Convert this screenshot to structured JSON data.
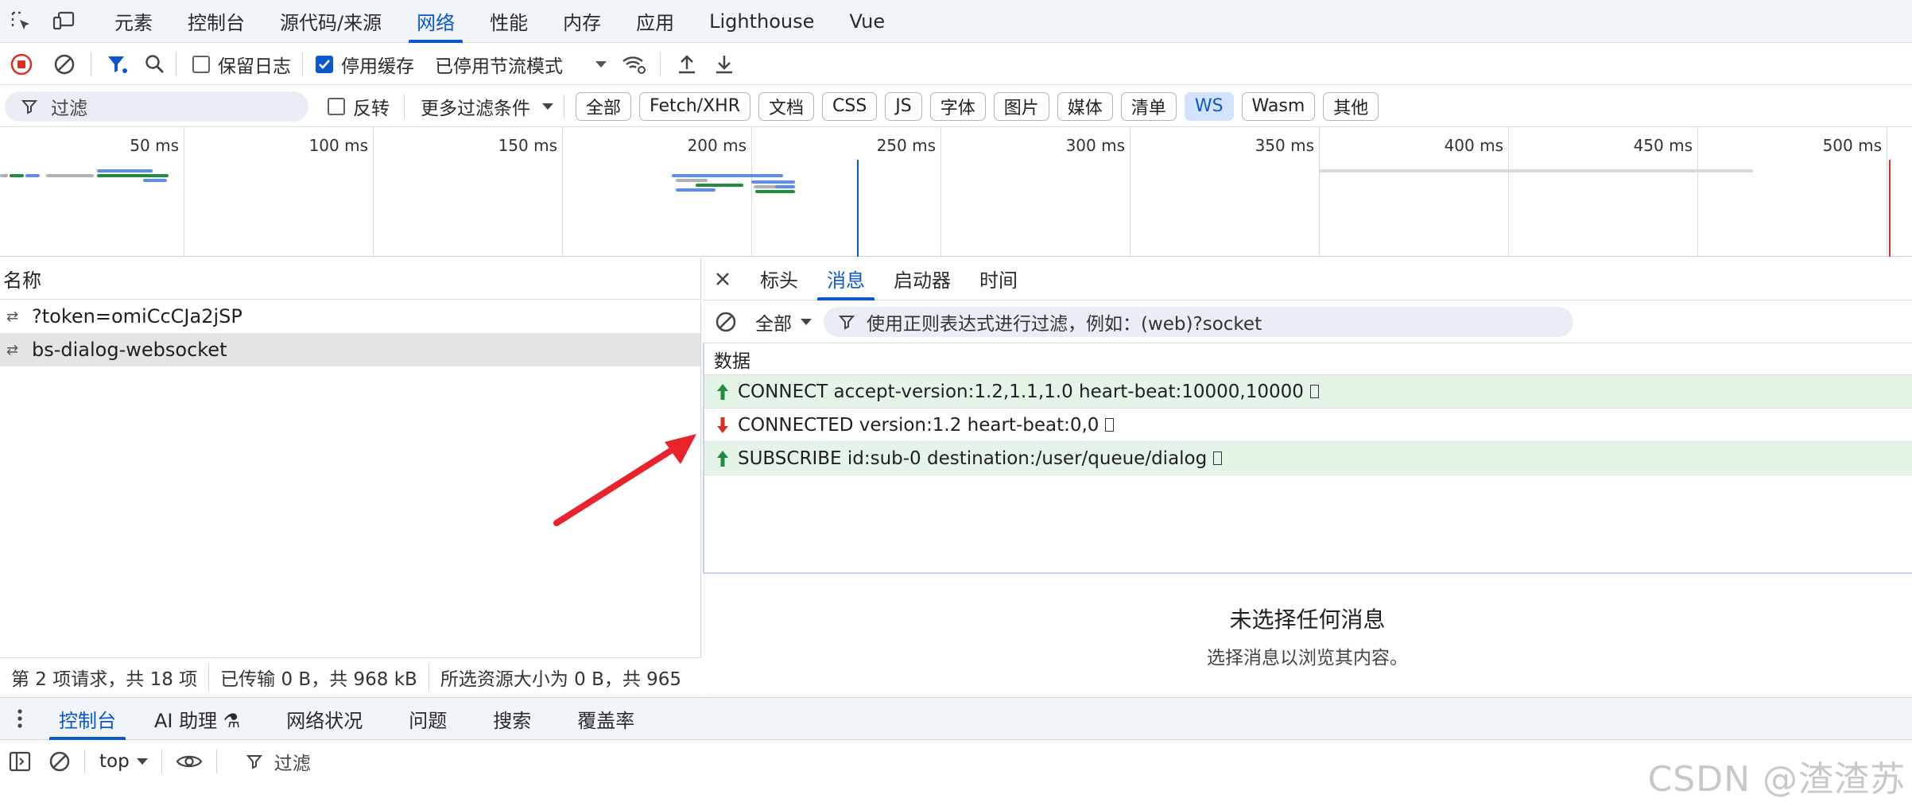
{
  "panel_tabs": [
    "元素",
    "控制台",
    "源代码/来源",
    "网络",
    "性能",
    "内存",
    "应用",
    "Lighthouse",
    "Vue"
  ],
  "toolbar": {
    "preserve_log": "保留日志",
    "disable_cache": "停用缓存",
    "throttle": "已停用节流模式"
  },
  "filter_row": {
    "filter_placeholder": "过滤",
    "invert": "反转",
    "more_filters": "更多过滤条件",
    "chips": [
      "全部",
      "Fetch/XHR",
      "文档",
      "CSS",
      "JS",
      "字体",
      "图片",
      "媒体",
      "清单",
      "WS",
      "Wasm",
      "其他"
    ],
    "active_chip": "WS"
  },
  "timeline": {
    "ticks": [
      "50 ms",
      "100 ms",
      "150 ms",
      "200 ms",
      "250 ms",
      "300 ms",
      "350 ms",
      "400 ms",
      "450 ms",
      "500 ms"
    ]
  },
  "requests": {
    "header": "名称",
    "rows": [
      "?token=omiCcCJa2jSP",
      "bs-dialog-websocket"
    ],
    "selected_index": 1
  },
  "status": {
    "requests": "第 2 项请求，共 18 项",
    "transferred": "已传输 0 B，共 968 kB",
    "resources": "所选资源大小为 0 B，共 965"
  },
  "detail": {
    "tabs": [
      "标头",
      "消息",
      "启动器",
      "时间"
    ],
    "active_tab": "消息",
    "msg_filter_type": "全部",
    "msg_filter_placeholder": "使用正则表达式进行过滤，例如：(web)?socket",
    "data_header": "数据",
    "messages": [
      {
        "direction": "sent",
        "text": "CONNECT accept-version:1.2,1.1,1.0 heart-beat:10000,10000"
      },
      {
        "direction": "received",
        "text": "CONNECTED version:1.2 heart-beat:0,0"
      },
      {
        "direction": "sent",
        "text": "SUBSCRIBE id:sub-0 destination:/user/queue/dialog"
      }
    ],
    "empty_title": "未选择任何消息",
    "empty_sub": "选择消息以浏览其内容。"
  },
  "drawer": {
    "tabs": [
      "控制台",
      "AI 助理 ⚗",
      "网络状况",
      "问题",
      "搜索",
      "覆盖率"
    ],
    "active_tab": "控制台",
    "context": "top",
    "filter_placeholder": "过滤"
  },
  "watermark": "CSDN @渣渣苏",
  "colors": {
    "accent": "#0b57d0",
    "sent_bg": "#e4f5e7",
    "sent_arrow": "#1e8e3e",
    "received_arrow": "#d93025",
    "record_red": "#d93025",
    "annotation_arrow": "#e8232c"
  }
}
